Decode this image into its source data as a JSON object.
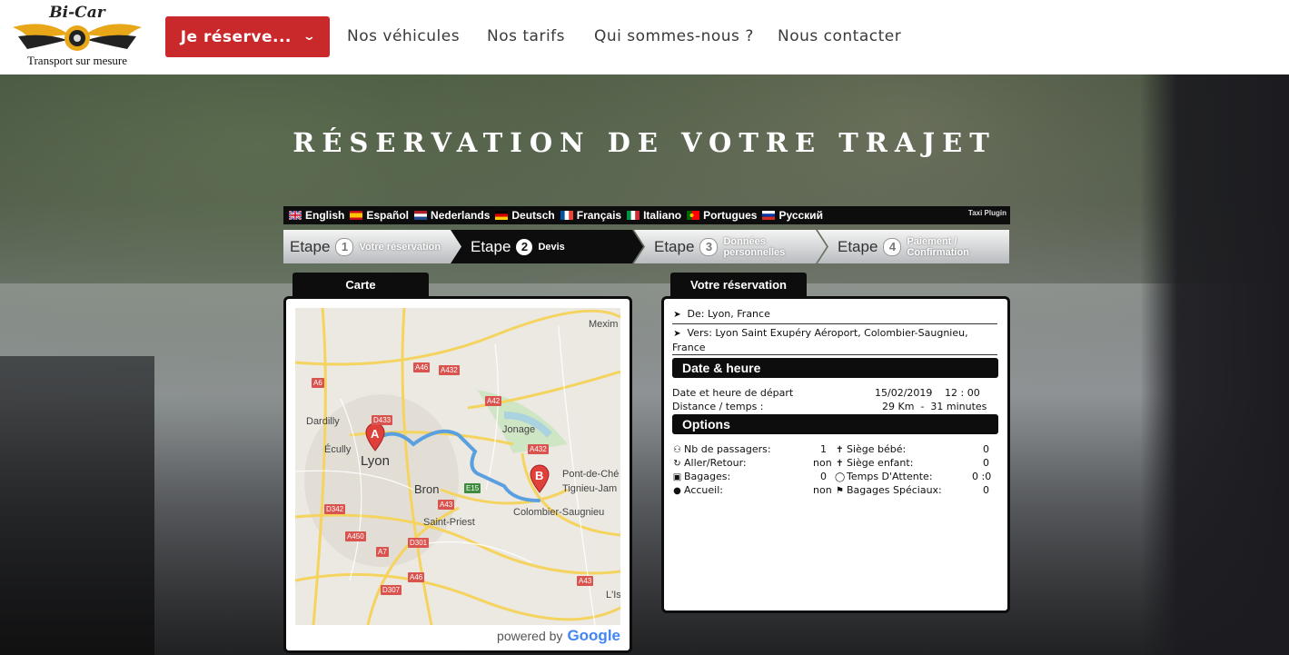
{
  "header": {
    "logo_title": "Bi-Car",
    "logo_subtitle": "Transport sur mesure",
    "reserve_label": "Je réserve...",
    "nav": [
      "Nos véhicules",
      "Nos tarifs",
      "Qui sommes-nous ?",
      "Nous contacter"
    ]
  },
  "page_title": "RÉSERVATION DE VOTRE TRAJET",
  "languages": [
    "English",
    "Español",
    "Nederlands",
    "Deutsch",
    "Français",
    "Italiano",
    "Portugues",
    "Русский"
  ],
  "plugin_label": "Taxi Plugin",
  "steps": [
    {
      "word": "Etape",
      "num": "1",
      "label": "Votre réservation",
      "state": "done"
    },
    {
      "word": "Etape",
      "num": "2",
      "label": "Devis",
      "state": "active"
    },
    {
      "word": "Etape",
      "num": "3",
      "label": "Données personnelles",
      "state": "todo"
    },
    {
      "word": "Etape",
      "num": "4",
      "label": "Paiement / Confirmation",
      "state": "todo"
    }
  ],
  "map_panel": {
    "tab": "Carte",
    "powered_by": "powered by",
    "google": "Google",
    "places": {
      "lyon": "Lyon",
      "bron": "Bron",
      "dardilly": "Dardilly",
      "ecully": "Écully",
      "jonage": "Jonage",
      "saint_priest": "Saint-Priest",
      "colombier": "Colombier-Saugnieu",
      "pont": "Pont-de-Ché",
      "tignieu": "Tignieu-Jam",
      "meximieux": "Mexim",
      "lisle": "L'Is"
    },
    "roads": [
      "A46",
      "A432",
      "A6",
      "A42",
      "D433",
      "A432",
      "E15",
      "A43",
      "D342",
      "A450",
      "D301",
      "A7",
      "A46",
      "D307",
      "A43"
    ],
    "marker_a": "A",
    "marker_b": "B"
  },
  "reservation": {
    "tab": "Votre réservation",
    "from": "De: Lyon, France",
    "to": "Vers: Lyon Saint Exupéry Aéroport, Colombier-Saugnieu, France",
    "date_section": "Date & heure",
    "departure_label": "Date et heure de départ",
    "departure_date": "15/02/2019",
    "departure_time": "12 : 00",
    "distance_label": "Distance / temps :",
    "distance_value": "29 Km  -  31 minutes",
    "options_section": "Options",
    "options_left": [
      {
        "icon": "users-icon",
        "label": "Nb de passagers:",
        "value": "1"
      },
      {
        "icon": "refresh-icon",
        "label": "Aller/Retour:",
        "value": "non"
      },
      {
        "icon": "briefcase-icon",
        "label": "Bagages:",
        "value": "0"
      },
      {
        "icon": "user-icon",
        "label": "Accueil:",
        "value": "non"
      }
    ],
    "options_right": [
      {
        "icon": "baby-icon",
        "label": "Siège bébé:",
        "value": "0"
      },
      {
        "icon": "child-icon",
        "label": "Siège enfant:",
        "value": "0"
      },
      {
        "icon": "clock-icon",
        "label": "Temps D'Attente:",
        "value": "0 :0"
      },
      {
        "icon": "flag-icon",
        "label": "Bagages Spéciaux:",
        "value": "0"
      }
    ]
  },
  "colors": {
    "accent_red": "#c9292b",
    "dark": "#0d0d0d",
    "route_blue": "#5aa0e0",
    "marker_red": "#e0403a"
  }
}
